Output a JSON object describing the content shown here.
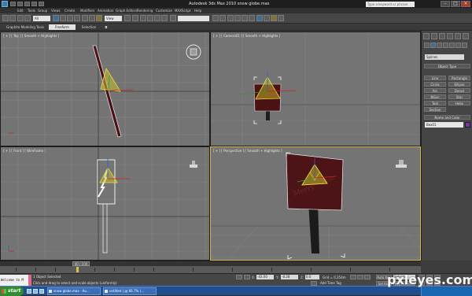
{
  "window": {
    "title": "Autodesk 3ds Max  2010     snow globe.max",
    "search_placeholder": "Type a keyword or phrase"
  },
  "menu": [
    "Edit",
    "Tools",
    "Group",
    "Views",
    "Create",
    "Modifiers",
    "Animation",
    "Graph Editors",
    "Rendering",
    "Customize",
    "MAXScript",
    "Help"
  ],
  "toolbar": {
    "selection_filter": "All",
    "reference_coord": "View"
  },
  "ribbon": {
    "tabs": [
      "Graphite Modeling Tools",
      "Freeform",
      "Selection",
      "◘"
    ],
    "active": 1
  },
  "viewports": {
    "top": "[ + ] [ Top ] [ Smooth + Highlights ]",
    "camera": "[ + ] [ Camera01 ] [ Smooth + Highlights ]",
    "front": "[ + ] [ Front ] [ Wireframe ]",
    "perspective": "[ + ] [ Perspective ] [ Smooth + Highlights ]"
  },
  "command_panel": {
    "category": "Splines",
    "object_type_header": "Object Type",
    "buttons": [
      "Line",
      "Rectangle",
      "Circle",
      "Ellipse",
      "Arc",
      "Donut",
      "NGon",
      "Star",
      "Text",
      "Helix",
      "Section"
    ],
    "name_color_header": "Name and Color",
    "name_value": "Box01",
    "swatch_color": "#7a33a8"
  },
  "timeline": {
    "thumb_label": "40 / 100"
  },
  "status": {
    "listener_text": "Welcome to M",
    "line1": "1 Object Selected",
    "line2": "Click and drag to select and scale objects (uniformly)",
    "x_label": "X:",
    "x_value": "-43.00",
    "y_label": "Y:",
    "y_value": "-8.28",
    "z_label": "Z:",
    "z_value": "0.0",
    "grid": "Grid = 0.254m",
    "add_time_tag": "Add Time Tag",
    "auto_key": "Auto Key",
    "set_key": "Set Key",
    "key_filter_value": "Selected",
    "key_filters": "Key Filters..."
  },
  "taskbar": {
    "start": "start",
    "tasks": [
      "snow globe.max - Au...",
      "untitled | @ 66.7% (..."
    ]
  },
  "watermark": "pxleyes.com"
}
